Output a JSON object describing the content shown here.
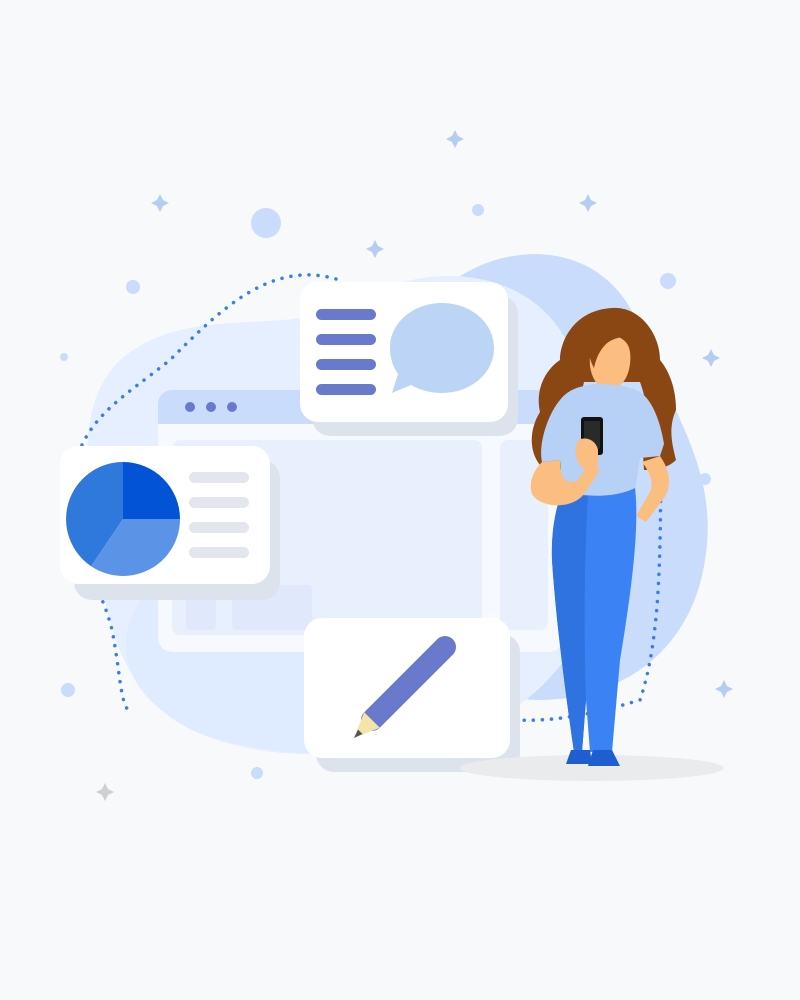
{
  "illustration": {
    "colors": {
      "page_background": "#f8f9fb",
      "blob_light": "#e6efff",
      "blob_mid": "#c9dcfb",
      "card": "#ffffff",
      "card_shadow": "#dde3ec",
      "placeholder_line": "#e3e6ec",
      "text_lines_indigo": "#6979cc",
      "chat_bubble": "#bcd4f6",
      "pie_primary": "#0353d6",
      "pie_secondary": "#2f78dc",
      "pie_tertiary": "#5b93e6",
      "dotted_path": "#3b7ee5",
      "sparkle": "#b5ccf3",
      "person_hair": "#8a4713",
      "person_skin": "#fbbd80",
      "person_shirt": "#b6d0f6",
      "person_pants": "#3b83f5",
      "person_shoes": "#1e5ed1",
      "phone": "#111111",
      "floor_shadow": "#eaebed"
    },
    "icons": [
      "browser-window-icon",
      "chat-bubble-icon",
      "text-lines-icon",
      "pie-chart-icon",
      "pencil-icon",
      "smartphone-icon",
      "sparkle-icon"
    ]
  }
}
